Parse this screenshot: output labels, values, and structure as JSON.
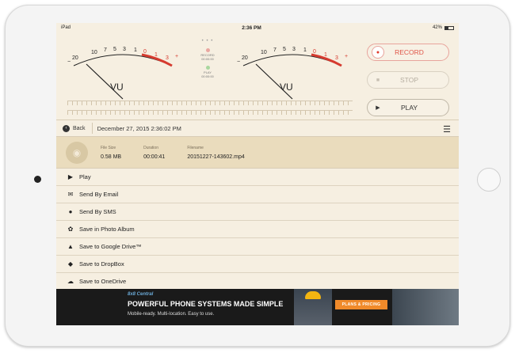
{
  "status": {
    "carrier": "iPad",
    "time": "2:36 PM",
    "battery": "42%"
  },
  "meters": {
    "scale_labels": [
      "20",
      "10",
      "7",
      "5",
      "3",
      "1",
      "0",
      "1",
      "3"
    ],
    "minus_sign": "−",
    "plus_sign": "+",
    "vu_label": "VU",
    "page_dots": "• • •",
    "record_small": "RECORD",
    "record_time": "00:00:00",
    "play_small": "PLAY",
    "play_time": "00:00:00"
  },
  "controls": {
    "record": "RECORD",
    "stop": "STOP",
    "play": "PLAY"
  },
  "nav": {
    "back": "Back",
    "title": "December 27, 2015 2:36:02 PM"
  },
  "file": {
    "size_label": "File Size",
    "size_value": "0.58 MB",
    "duration_label": "Duration",
    "duration_value": "00:00:41",
    "filename_label": "Filename",
    "filename_value": "20151227-143602.mp4"
  },
  "actions": [
    {
      "label": "Play",
      "icon": "play-icon"
    },
    {
      "label": "Send By Email",
      "icon": "email-icon"
    },
    {
      "label": "Send By SMS",
      "icon": "sms-icon"
    },
    {
      "label": "Save in Photo Album",
      "icon": "photo-album-icon"
    },
    {
      "label": "Save to Google Drive™",
      "icon": "google-drive-icon"
    },
    {
      "label": "Save to DropBox",
      "icon": "dropbox-icon"
    },
    {
      "label": "Save to OneDrive",
      "icon": "onedrive-icon"
    }
  ],
  "ad": {
    "brand": "8x8 Central",
    "headline": "POWERFUL PHONE SYSTEMS MADE SIMPLE",
    "sub": "Mobile-ready. Multi-location. Easy to use.",
    "cta": "PLANS & PRICING"
  },
  "colors": {
    "accent_red": "#e05548",
    "background": "#f6efe1",
    "file_row": "#eadcbd"
  }
}
